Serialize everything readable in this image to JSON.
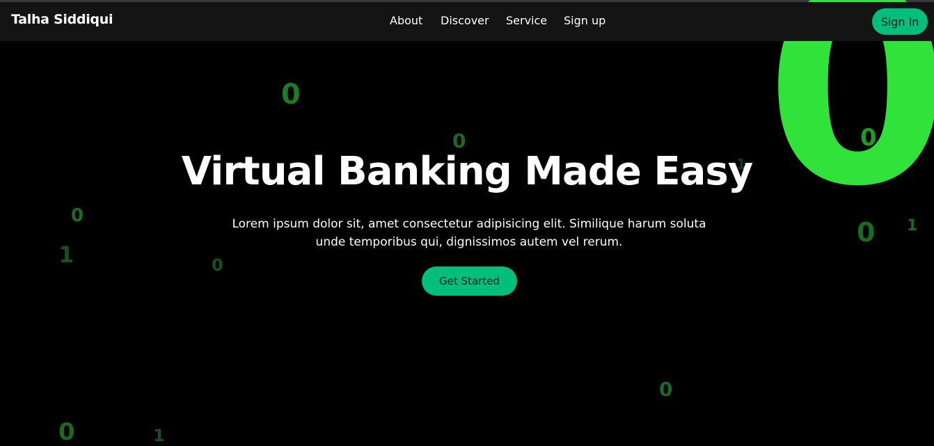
{
  "header": {
    "brand": "Talha Siddiqui",
    "nav": [
      "About",
      "Discover",
      "Service",
      "Sign up"
    ],
    "signin_label": "Sign In"
  },
  "hero": {
    "title": "Virtual Banking Made Easy",
    "description": "Lorem ipsum dolor sit, amet consectetur adipisicing elit. Similique harum soluta unde temporibus qui, dignissimos autem vel rerum.",
    "cta_label": "Get Started"
  },
  "background_digits": [
    "0",
    "0",
    "0",
    "1",
    "0",
    "0",
    "0",
    "1",
    "1",
    "0",
    "0",
    "1",
    "0"
  ],
  "colors": {
    "background": "#000000",
    "navbar": "#141414",
    "accent": "#00be7b",
    "matrix_green": "#30e23a"
  }
}
